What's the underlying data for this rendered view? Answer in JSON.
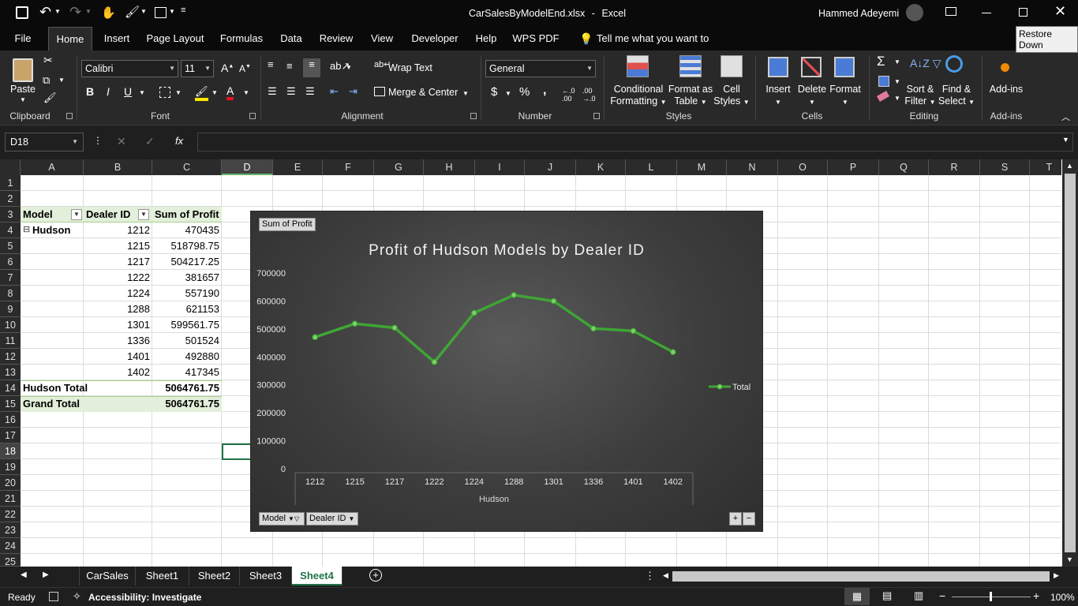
{
  "title_bar": {
    "filename": "CarSalesByModelEnd.xlsx",
    "separator": "-",
    "app": "Excel",
    "user": "Hammed Adeyemi",
    "tooltip": "Restore Down"
  },
  "menu": {
    "tabs": [
      "File",
      "Home",
      "Insert",
      "Page Layout",
      "Formulas",
      "Data",
      "Review",
      "View",
      "Developer",
      "Help",
      "WPS PDF"
    ],
    "active": "Home",
    "tell_me": "Tell me what you want to do"
  },
  "ribbon": {
    "clipboard": {
      "paste": "Paste",
      "label": "Clipboard"
    },
    "font": {
      "name": "Calibri",
      "size": "11",
      "label": "Font",
      "bold": "B",
      "italic": "I",
      "underline": "U"
    },
    "alignment": {
      "wrap": "Wrap Text",
      "merge": "Merge & Center",
      "label": "Alignment"
    },
    "number": {
      "format": "General",
      "label": "Number",
      "currency": "$",
      "percent": "%",
      "comma": ","
    },
    "styles": {
      "conditional": "Conditional",
      "conditional2": "Formatting",
      "format_table": "Format as",
      "format_table2": "Table",
      "cell_styles": "Cell",
      "cell_styles2": "Styles",
      "label": "Styles"
    },
    "cells": {
      "insert": "Insert",
      "delete": "Delete",
      "format": "Format",
      "label": "Cells"
    },
    "editing": {
      "sort": "Sort &",
      "sort2": "Filter",
      "find": "Find &",
      "find2": "Select",
      "label": "Editing"
    },
    "addins": {
      "btn": "Add-ins",
      "label": "Add-ins"
    }
  },
  "formula_bar": {
    "name_box": "D18",
    "fx": "fx",
    "value": ""
  },
  "columns": [
    "A",
    "B",
    "C",
    "D",
    "E",
    "F",
    "G",
    "H",
    "I",
    "J",
    "K",
    "L",
    "M",
    "N",
    "O",
    "P",
    "Q",
    "R",
    "S",
    "T"
  ],
  "rows": [
    "1",
    "2",
    "3",
    "4",
    "5",
    "6",
    "7",
    "8",
    "9",
    "10",
    "11",
    "12",
    "13",
    "14",
    "15",
    "16",
    "17",
    "18",
    "19",
    "20",
    "21",
    "22",
    "23",
    "24",
    "25"
  ],
  "pivot": {
    "headers": [
      "Model",
      "Dealer ID",
      "Sum of Profit"
    ],
    "model": "Hudson",
    "collapse": "⊟",
    "rows": [
      {
        "id": "1212",
        "profit": "470435"
      },
      {
        "id": "1215",
        "profit": "518798.75"
      },
      {
        "id": "1217",
        "profit": "504217.25"
      },
      {
        "id": "1222",
        "profit": "381657"
      },
      {
        "id": "1224",
        "profit": "557190"
      },
      {
        "id": "1288",
        "profit": "621153"
      },
      {
        "id": "1301",
        "profit": "599561.75"
      },
      {
        "id": "1336",
        "profit": "501524"
      },
      {
        "id": "1401",
        "profit": "492880"
      },
      {
        "id": "1402",
        "profit": "417345"
      }
    ],
    "subtotal_label": "Hudson Total",
    "subtotal": "5064761.75",
    "grand_label": "Grand Total",
    "grand": "5064761.75"
  },
  "chart_data": {
    "type": "line",
    "title": "Profit of Hudson Models by Dealer ID",
    "value_field_button": "Sum of Profit",
    "categories": [
      "1212",
      "1215",
      "1217",
      "1222",
      "1224",
      "1288",
      "1301",
      "1336",
      "1401",
      "1402"
    ],
    "group_label": "Hudson",
    "series": [
      {
        "name": "Total",
        "values": [
          470435,
          518798.75,
          504217.25,
          381657,
          557190,
          621153,
          599561.75,
          501524,
          492880,
          417345
        ]
      }
    ],
    "y_ticks": [
      "0",
      "100000",
      "200000",
      "300000",
      "400000",
      "500000",
      "600000",
      "700000"
    ],
    "ylim": [
      0,
      700000
    ],
    "legend": "right",
    "filter_buttons": [
      "Model",
      "Dealer ID"
    ],
    "line_color": "#3fa535"
  },
  "sheets": {
    "tabs": [
      "CarSales",
      "Sheet1",
      "Sheet2",
      "Sheet3",
      "Sheet4"
    ],
    "active": "Sheet4"
  },
  "status": {
    "ready": "Ready",
    "accessibility": "Accessibility: Investigate",
    "zoom": "100%"
  }
}
